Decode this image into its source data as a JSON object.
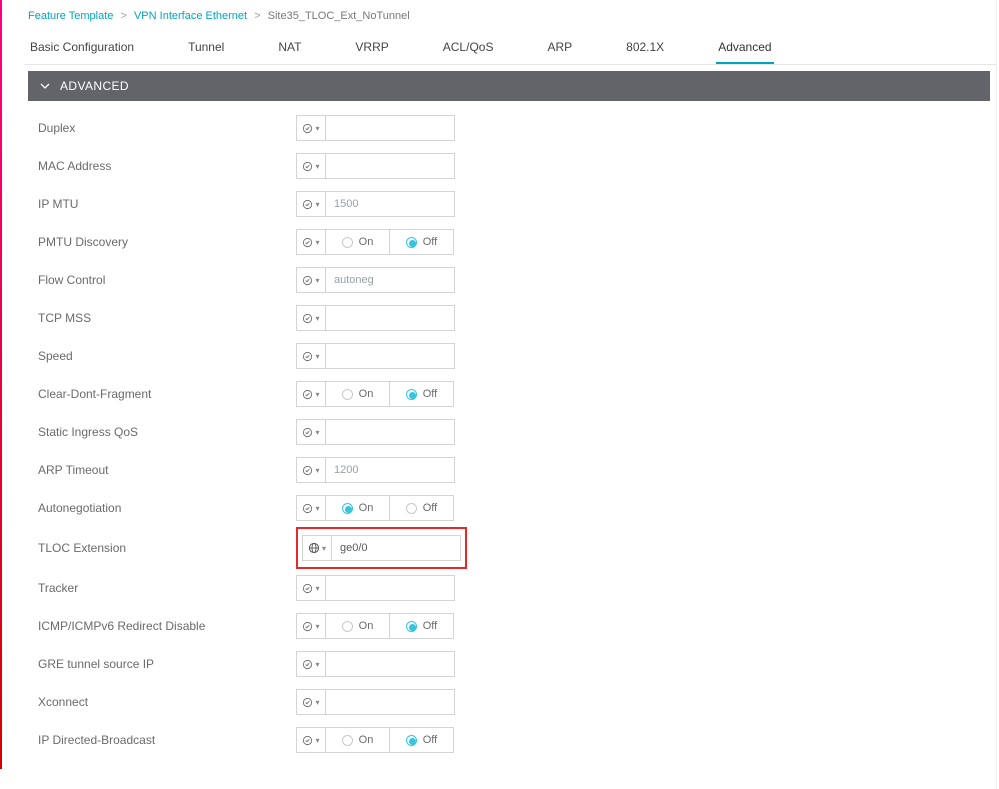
{
  "breadcrumb": {
    "level1": "Feature Template",
    "level2": "VPN Interface Ethernet",
    "level3": "Site35_TLOC_Ext_NoTunnel",
    "sep": ">"
  },
  "tabs": {
    "t0": "Basic Configuration",
    "t1": "Tunnel",
    "t2": "NAT",
    "t3": "VRRP",
    "t4": "ACL/QoS",
    "t5": "ARP",
    "t6": "802.1X",
    "t7": "Advanced"
  },
  "panel": {
    "title": "ADVANCED"
  },
  "rows": {
    "duplex": {
      "label": "Duplex",
      "value": ""
    },
    "mac": {
      "label": "MAC Address",
      "value": ""
    },
    "ipmtu": {
      "label": "IP MTU",
      "value": "1500"
    },
    "pmtu": {
      "label": "PMTU Discovery",
      "on": "On",
      "off": "Off",
      "sel": "off"
    },
    "flow": {
      "label": "Flow Control",
      "value": "autoneg"
    },
    "tcpmss": {
      "label": "TCP MSS",
      "value": ""
    },
    "speed": {
      "label": "Speed",
      "value": ""
    },
    "cdf": {
      "label": "Clear-Dont-Fragment",
      "on": "On",
      "off": "Off",
      "sel": "off"
    },
    "siqos": {
      "label": "Static Ingress QoS",
      "value": ""
    },
    "arpto": {
      "label": "ARP Timeout",
      "value": "1200"
    },
    "autoneg": {
      "label": "Autonegotiation",
      "on": "On",
      "off": "Off",
      "sel": "on"
    },
    "tloc": {
      "label": "TLOC Extension",
      "value": "ge0/0"
    },
    "tracker": {
      "label": "Tracker",
      "value": ""
    },
    "icmp": {
      "label": "ICMP/ICMPv6 Redirect Disable",
      "on": "On",
      "off": "Off",
      "sel": "off"
    },
    "gre": {
      "label": "GRE tunnel source IP",
      "value": ""
    },
    "xc": {
      "label": "Xconnect",
      "value": ""
    },
    "ipdb": {
      "label": "IP Directed-Broadcast",
      "on": "On",
      "off": "Off",
      "sel": "off"
    }
  }
}
